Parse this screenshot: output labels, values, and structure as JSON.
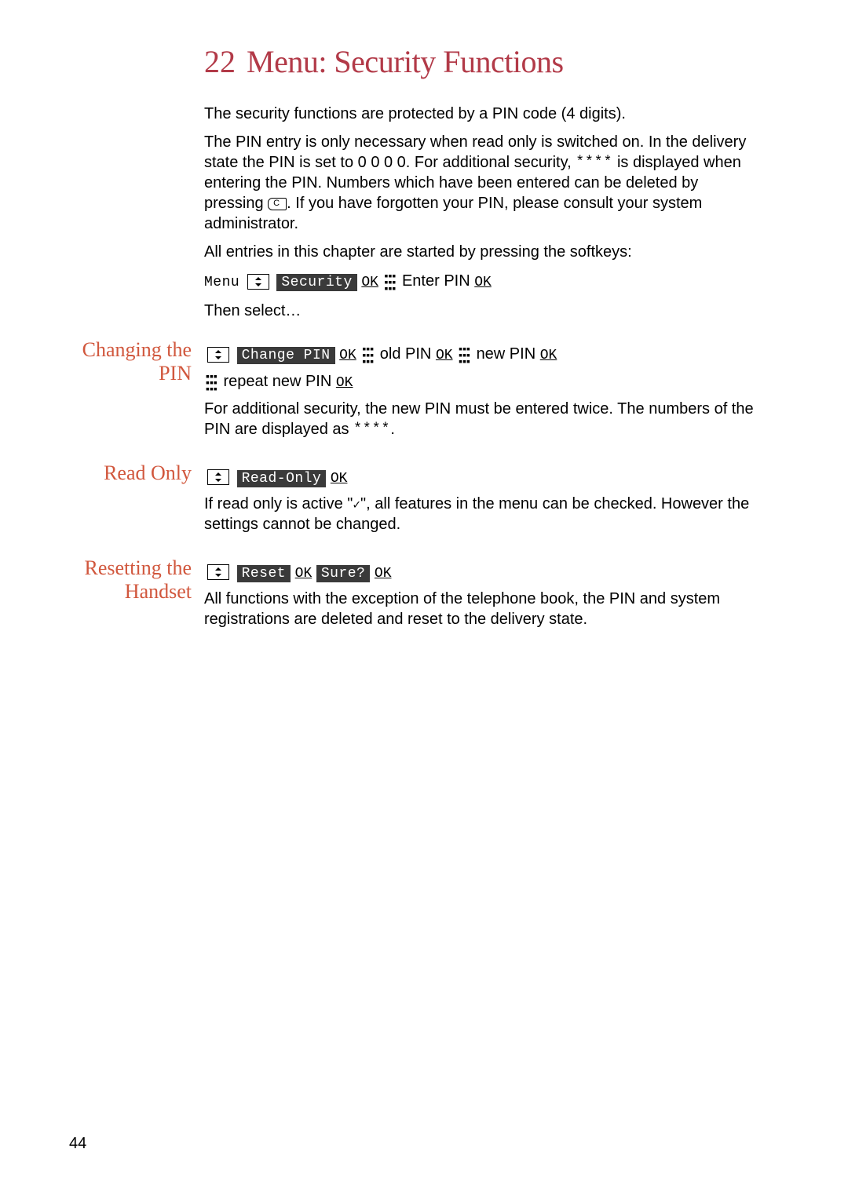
{
  "chapter": {
    "number": "22",
    "title": "Menu: Security Functions"
  },
  "intro": {
    "p1": "The security functions are protected by a PIN code (4 digits).",
    "p2a": "The PIN entry is only necessary when read only is switched on. In the delivery state the PIN is set to 0 0 0 0. For additional security, ",
    "p2b": " is displayed when entering the PIN. Numbers which have been entered can be deleted by pressing ",
    "p2c": ". If you have forgotten your PIN, please consult your system administrator.",
    "p3": "All entries in this chapter are started by pressing the softkeys:",
    "softkey": {
      "menu": "Menu",
      "security": "Security",
      "ok": "OK",
      "enterpin": "Enter PIN"
    },
    "then": "Then select…"
  },
  "changing_pin": {
    "heading": "Changing the PIN",
    "line1": {
      "change": "Change PIN",
      "ok": "OK",
      "old": "old PIN",
      "new": "new PIN"
    },
    "line2": {
      "repeat": "repeat new PIN",
      "ok": "OK"
    },
    "body_a": "For additional security, the new PIN must be entered twice. The numbers of the PIN are displayed as ",
    "body_b": "."
  },
  "read_only": {
    "heading": "Read Only",
    "line": {
      "label": "Read-Only",
      "ok": "OK"
    },
    "body_a": "If read only is active \"",
    "body_b": "\", all features in the menu can be checked. However the settings cannot be changed."
  },
  "resetting": {
    "heading": "Resetting the Handset",
    "line": {
      "reset": "Reset",
      "ok": "OK",
      "sure": "Sure?"
    },
    "body": "All functions with the exception of the telephone book, the PIN and system registrations are deleted and reset to the delivery state."
  },
  "page_number": "44",
  "glyphs": {
    "asterisks": "****",
    "check": "✓"
  }
}
